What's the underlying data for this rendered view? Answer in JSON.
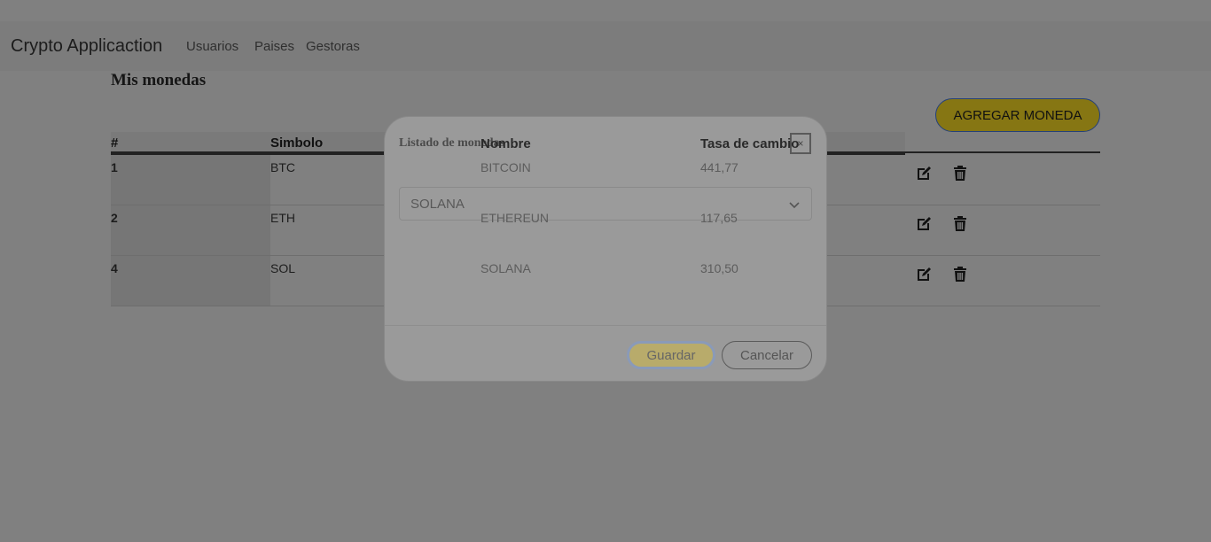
{
  "navbar": {
    "brand": "Crypto Applicaction",
    "links": [
      "Usuarios",
      "Paises",
      "Gestoras"
    ]
  },
  "page": {
    "title": "Mis monedas",
    "add_button": "AGREGAR MONEDA"
  },
  "table": {
    "headers": [
      "#",
      "Simbolo",
      "Nombre",
      "Tasa de cambio"
    ],
    "rows": [
      {
        "id": "1",
        "symbol": "BTC",
        "name": "BITCOIN",
        "rate": "441,77"
      },
      {
        "id": "2",
        "symbol": "ETH",
        "name": "ETHEREUN",
        "rate": "117,65"
      },
      {
        "id": "4",
        "symbol": "SOL",
        "name": "SOLANA",
        "rate": "310,50"
      }
    ],
    "row_actions": [
      "edit-icon",
      "trash-icon"
    ]
  },
  "dialog": {
    "title": "Listado de monedas",
    "close": "×",
    "select_value": "SOLANA",
    "save": "Guardar",
    "cancel": "Cancelar"
  },
  "colors": {
    "backdrop": "#808080",
    "accent_yellow": "#867613",
    "save_button": "#b8ab6b"
  }
}
